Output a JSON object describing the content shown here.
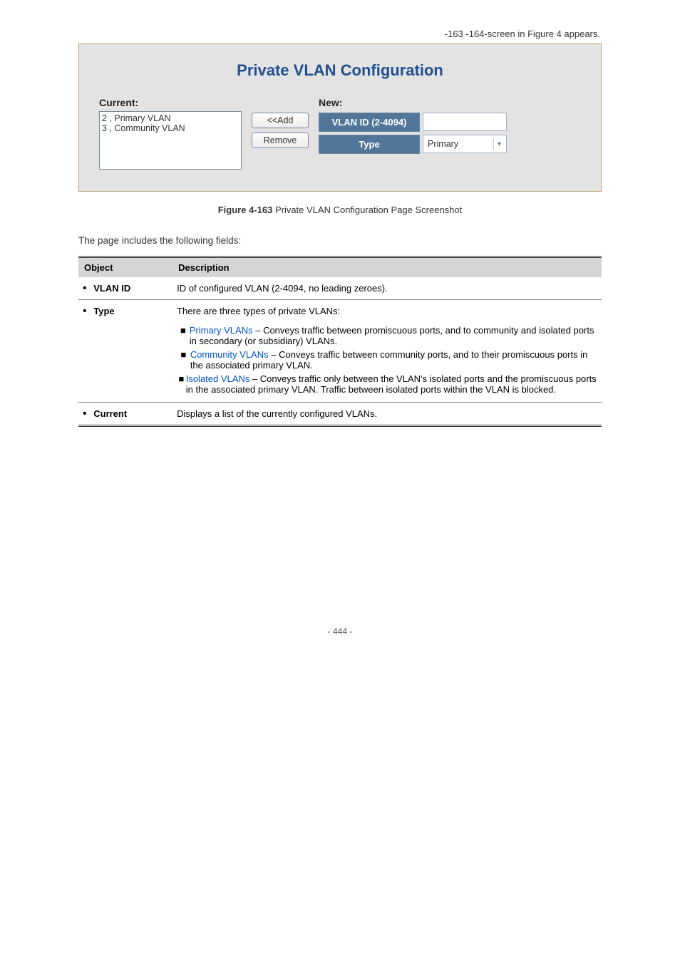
{
  "topCaptionRef": "-163 -164-screen in Figure 4 appears.",
  "figure": {
    "title": "Private VLAN Configuration",
    "currentLabel": "Current:",
    "newLabel": "New:",
    "listItems": [
      "2 , Primary VLAN",
      "3 , Community VLAN"
    ],
    "addBtn": "<<Add",
    "removeBtn": "Remove",
    "vlanIdHeader": "VLAN ID (2-4094)",
    "typeHeader": "Type",
    "typeSelected": "Primary",
    "caption": "Figure 4-163 Private VLAN Configuration Page Screenshot"
  },
  "bodyText": "The page includes the following fields:",
  "table": {
    "head": {
      "object": "Object",
      "description": "Description"
    },
    "rows": [
      {
        "object": "VLAN ID",
        "description": "ID of configured VLAN (2-4094, no leading zeroes)."
      },
      {
        "object": "Type",
        "description": "There are three types of private VLANs:",
        "nested": [
          {
            "label": "Primary VLANs",
            "text": " – Conveys traffic between promiscuous ports, and to community and isolated ports in secondary (or subsidiary) VLANs."
          },
          {
            "label": "Community VLANs",
            "text": " – Conveys traffic between community ports, and to their promiscuous ports in the associated primary VLAN."
          },
          {
            "label": "Isolated VLANs",
            "text": " – Conveys traffic only between the VLAN's isolated ports and the promiscuous ports in the associated primary VLAN. Traffic between isolated ports within the VLAN is blocked."
          }
        ]
      },
      {
        "object": "Current",
        "description": "Displays a list of the currently configured VLANs."
      }
    ]
  },
  "footer": "- 444 -"
}
